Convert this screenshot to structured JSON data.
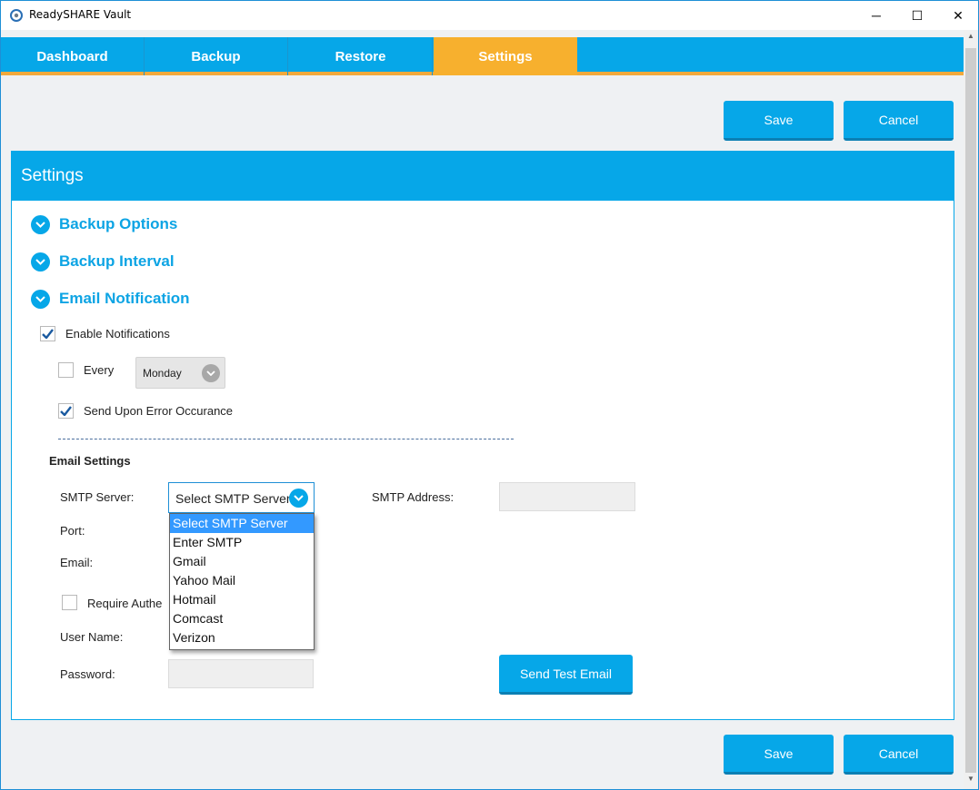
{
  "window": {
    "title": "ReadySHARE Vault",
    "controls": {
      "minimize": "─",
      "maximize": "☐",
      "close": "✕"
    }
  },
  "nav": {
    "tabs": [
      {
        "label": "Dashboard"
      },
      {
        "label": "Backup"
      },
      {
        "label": "Restore"
      },
      {
        "label": "Settings",
        "active": true
      }
    ]
  },
  "actions": {
    "save_label": "Save",
    "cancel_label": "Cancel"
  },
  "panel": {
    "title": "Settings",
    "sections": [
      {
        "label": "Backup Options"
      },
      {
        "label": "Backup Interval"
      },
      {
        "label": "Email Notification"
      }
    ]
  },
  "email_notification": {
    "enable": {
      "label": "Enable Notifications",
      "checked": true
    },
    "every": {
      "label": "Every",
      "checked": false,
      "day": "Monday"
    },
    "on_error": {
      "label": "Send Upon Error Occurance",
      "checked": true
    }
  },
  "email_settings": {
    "heading": "Email Settings",
    "smtp_server_label": "SMTP Server:",
    "smtp_server_value": "Select SMTP Server",
    "smtp_address_label": "SMTP Address:",
    "port_label": "Port:",
    "email_label": "Email:",
    "require_auth_label": "Require Authe",
    "user_name_label": "User Name:",
    "password_label": "Password:",
    "send_test_label": "Send Test Email",
    "smtp_options": [
      "Select SMTP Server",
      "Enter SMTP",
      "Gmail",
      "Yahoo Mail",
      "Hotmail",
      "Comcast",
      "Verizon"
    ]
  },
  "colors": {
    "accent": "#06a7e8",
    "active_tab": "#f7b02e",
    "selection": "#3399ff"
  }
}
